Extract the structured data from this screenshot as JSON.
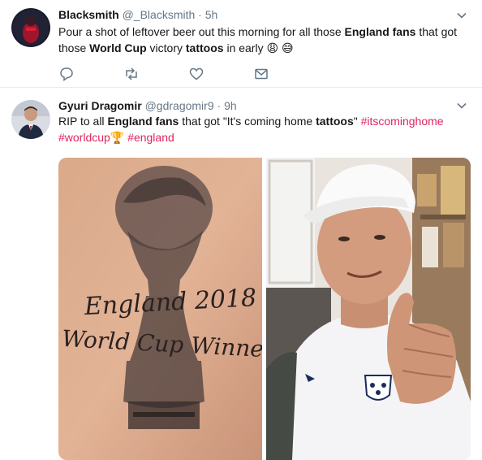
{
  "tweets": [
    {
      "name": "Blacksmith",
      "handle": "@_Blacksmith",
      "separator": "·",
      "time": "5h",
      "text": {
        "p1": "Pour a shot of leftover beer out this morning for all those ",
        "b1": "England fans",
        "p2": " that got those ",
        "b2": "World Cup",
        "p3": " victory ",
        "b3": "tattoos",
        "p4": " in early ",
        "emoji1": "😩",
        "emoji2": "😅"
      },
      "actions": [
        "reply-icon",
        "retweet-icon",
        "like-icon",
        "message-icon"
      ]
    },
    {
      "name": "Gyuri Dragomir",
      "handle": "@gdragomir9",
      "separator": "·",
      "time": "9h",
      "text": {
        "p1": "RIP to all ",
        "b1": "England fans",
        "p2": " that got \"It's coming home ",
        "b2": "tattoos",
        "p3": "\" ",
        "tag1": "#itscominghome",
        "tag2": "#worldcup",
        "emoji1": "🏆",
        "tag3": "#england"
      },
      "media": {
        "left_image": {
          "tattoo_line1": "England 2018",
          "tattoo_line2": "World Cup Winners"
        },
        "right_image": "photo-of-man-thumbs-up"
      }
    }
  ],
  "colors": {
    "text": "#14171a",
    "secondary": "#657786",
    "hashtag": "#e0245e",
    "icon": "#657786",
    "divider": "#e6ecf0"
  }
}
